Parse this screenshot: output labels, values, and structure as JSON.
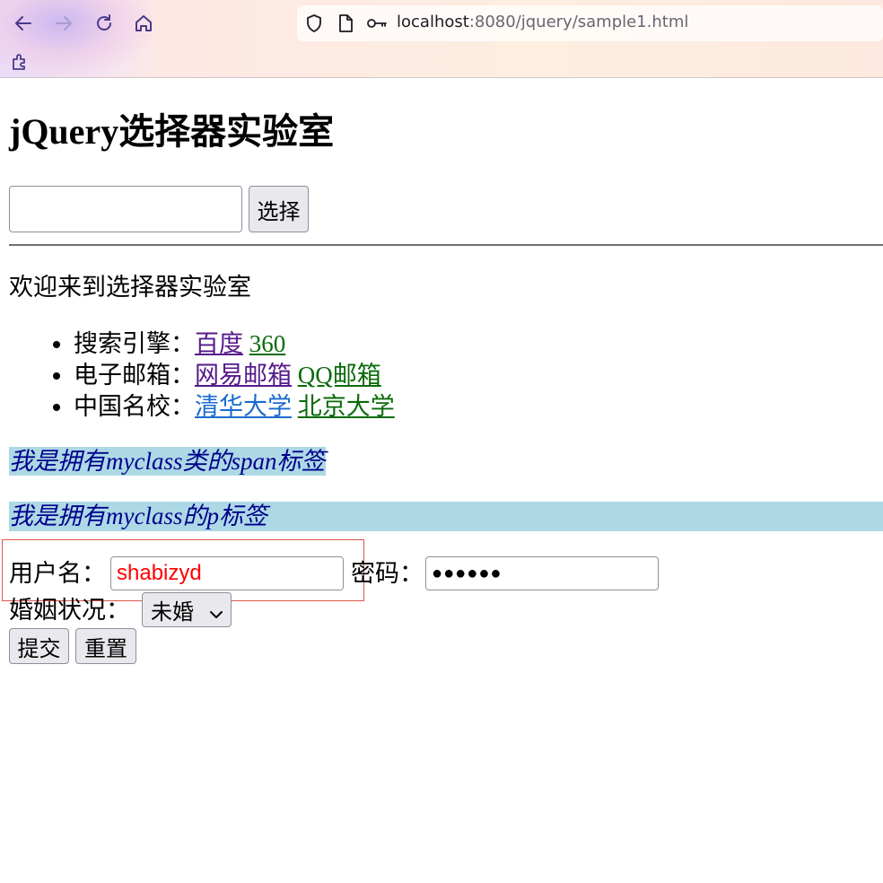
{
  "browser": {
    "url_host": "localhost",
    "url_path": ":8080/jquery/sample1.html",
    "icons": [
      "back-icon",
      "forward-icon",
      "reload-icon",
      "home-icon",
      "shield-icon",
      "page-icon",
      "key-icon",
      "extensions-icon"
    ]
  },
  "page": {
    "title": "jQuery选择器实验室",
    "selector_input": {
      "value": "",
      "placeholder": ""
    },
    "select_button": "选择",
    "welcome": "欢迎来到选择器实验室",
    "link_groups": [
      {
        "label": "搜索引擎：",
        "links": [
          "百度",
          "360"
        ]
      },
      {
        "label": "电子邮箱：",
        "links": [
          "网易邮箱",
          "QQ邮箱"
        ]
      },
      {
        "label": "中国名校：",
        "links": [
          "清华大学",
          "北京大学"
        ]
      }
    ],
    "span_text": "我是拥有myclass类的span标签",
    "p_text": "我是拥有myclass的p标签",
    "form": {
      "username_label": "用户名：",
      "username_value": "shabizyd",
      "password_label": "密码：",
      "password_mask": "●●●●●●",
      "marital_label": "婚姻状况：",
      "marital_selected": "未婚",
      "submit": "提交",
      "reset": "重置"
    }
  },
  "colors": {
    "highlight_bg": "#add8e6",
    "highlight_text": "#00008b",
    "visited_link": "#551a8b",
    "green_link": "#0a6b0a",
    "blue_link": "#1a6bd0",
    "username_text": "#ff0000",
    "selection_border": "#e0564a"
  }
}
